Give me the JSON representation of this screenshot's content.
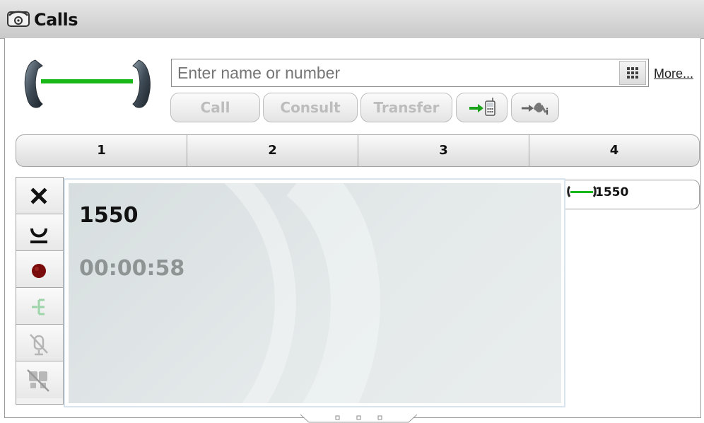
{
  "window": {
    "title": "Calls"
  },
  "dialer": {
    "input_value": "",
    "input_placeholder": "Enter name or number",
    "more_label": "More...",
    "buttons": {
      "call": "Call",
      "consult": "Consult",
      "transfer": "Transfer"
    }
  },
  "tabs": [
    "1",
    "2",
    "3",
    "4"
  ],
  "active_call": {
    "number": "1550",
    "duration": "00:00:58",
    "tab_label": "1550"
  },
  "colors": {
    "connected_line": "#17b817",
    "record_dot": "#7a0b0b",
    "timer_text": "#8e9393"
  },
  "icons": {
    "title": "telephone-icon",
    "dial_status": "handset-connected-icon",
    "keypad": "keypad-icon",
    "push_to_mobile": "push-to-mobile-icon",
    "transfer_to_voicemail": "transfer-to-voicemail-icon",
    "drop": "close-icon",
    "hold": "hold-icon",
    "record": "record-icon",
    "conference": "conference-icon",
    "mute": "mute-icon",
    "ignore": "ignore-icon"
  }
}
